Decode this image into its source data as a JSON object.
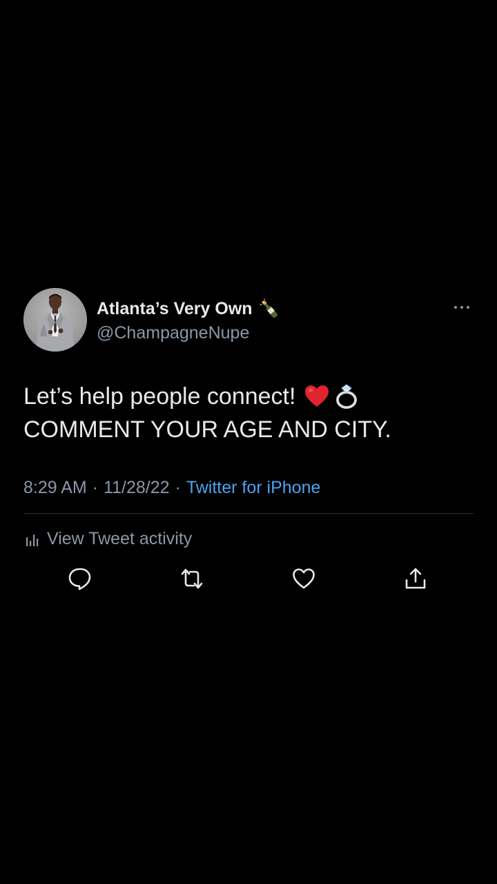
{
  "tweet": {
    "display_name": "Atlanta’s Very Own",
    "handle": "@ChampagneNupe",
    "text_line1": "Let’s help people connect!",
    "text_line2": "COMMENT YOUR AGE AND CITY.",
    "time": "8:29 AM",
    "separator1": "·",
    "date": "11/28/22",
    "separator2": "·",
    "source": "Twitter for iPhone",
    "activity_label": "View Tweet activity"
  },
  "icons": {
    "name_emoji": "champagne-bottle-icon",
    "emoji_1": "red-heart-icon",
    "emoji_2": "ring-icon",
    "more": "more-icon",
    "activity": "bar-chart-icon",
    "reply": "reply-icon",
    "retweet": "retweet-icon",
    "like": "heart-icon",
    "share": "share-icon"
  },
  "colors": {
    "background": "#000000",
    "text_primary": "#e7e9ea",
    "text_secondary": "#8b98a5",
    "link": "#4ba3ef",
    "divider": "#2f3336"
  }
}
